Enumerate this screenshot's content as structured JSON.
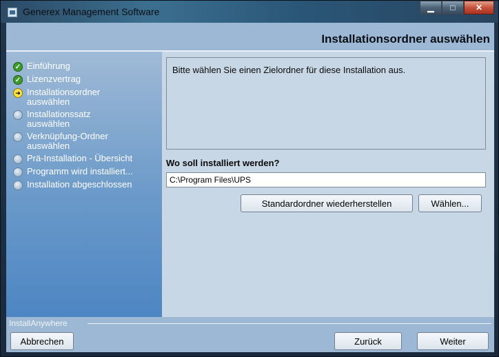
{
  "window": {
    "title": "Generex Management Software"
  },
  "header": {
    "page_title": "Installationsordner auswählen"
  },
  "steps": [
    {
      "label": "Einführung",
      "state": "done"
    },
    {
      "label": "Lizenzvertrag",
      "state": "done"
    },
    {
      "label": "Installationsordner auswählen",
      "state": "current"
    },
    {
      "label": "Installationssatz auswählen",
      "state": "pending"
    },
    {
      "label": "Verknüpfung-Ordner auswählen",
      "state": "pending"
    },
    {
      "label": "Prä-Installation - Übersicht",
      "state": "pending"
    },
    {
      "label": "Programm wird installiert...",
      "state": "pending"
    },
    {
      "label": "Installation abgeschlossen",
      "state": "pending"
    }
  ],
  "main": {
    "info_text": "Bitte wählen Sie einen Zielordner für diese Installation aus.",
    "question": "Wo soll installiert werden?",
    "path_value": "C:\\Program Files\\UPS",
    "restore_button": "Standardordner wiederherstellen",
    "choose_button": "Wählen..."
  },
  "footer": {
    "brand": "InstallAnywhere",
    "cancel_button": "Abbrechen",
    "back_button": "Zurück",
    "next_button": "Weiter"
  },
  "icons": {
    "done": "check-circle-icon",
    "current": "arrow-circle-icon",
    "pending": "empty-circle-icon"
  },
  "colors": {
    "sidebar_top": "#9fbad6",
    "sidebar_bottom": "#4d86c3",
    "content_bg": "#c8d7e6",
    "done_green": "#3d9b2b",
    "current_yellow": "#ffe14a"
  }
}
